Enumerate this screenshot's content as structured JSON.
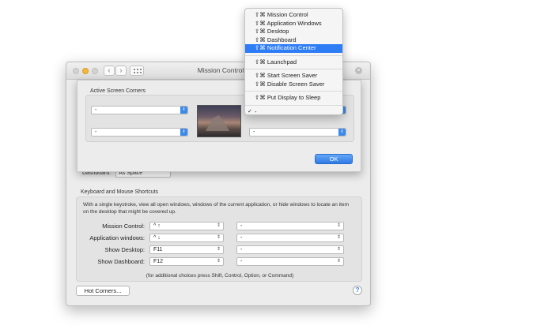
{
  "window": {
    "title": "Mission Control",
    "nav_back": "‹",
    "nav_forward": "›",
    "search_clear": "×"
  },
  "dashboard_row": {
    "label": "Dashboard:",
    "value": "As Space"
  },
  "shortcuts": {
    "section_title": "Keyboard and Mouse Shortcuts",
    "description": "With a single keystroke, view all open windows, windows of the current application, or hide windows to locate an item on the desktop that might be covered up.",
    "rows": [
      {
        "label": "Mission Control:",
        "key": "^ ↑",
        "mouse": "-"
      },
      {
        "label": "Application windows:",
        "key": "^ ↓",
        "mouse": "-"
      },
      {
        "label": "Show Desktop:",
        "key": "F11",
        "mouse": "-"
      },
      {
        "label": "Show Dashboard:",
        "key": "F12",
        "mouse": "-"
      }
    ],
    "note": "(for additional choices press Shift, Control, Option, or Command)"
  },
  "hot_corners_button": "Hot Corners...",
  "help_button": "?",
  "sheet": {
    "title": "Active Screen Corners",
    "top_left": "-",
    "bottom_left": "-",
    "bottom_right": "-",
    "ok_label": "OK"
  },
  "menu": {
    "items": [
      "⇧⌘ Mission Control",
      "⇧⌘ Application Windows",
      "⇧⌘ Desktop",
      "⇧⌘ Dashboard",
      "⇧⌘ Notification Center",
      "⇧⌘ Launchpad",
      "⇧⌘ Start Screen Saver",
      "⇧⌘ Disable Screen Saver",
      "⇧⌘ Put Display to Sleep",
      "-"
    ],
    "selected_index": 4,
    "checked_index": 9,
    "checkmark": "✓"
  },
  "colors": {
    "accent": "#2e7df6",
    "ok_button": "#2f7ae5"
  },
  "icons": {
    "popup_arrows": "updown-arrows-icon",
    "help": "help-icon"
  }
}
